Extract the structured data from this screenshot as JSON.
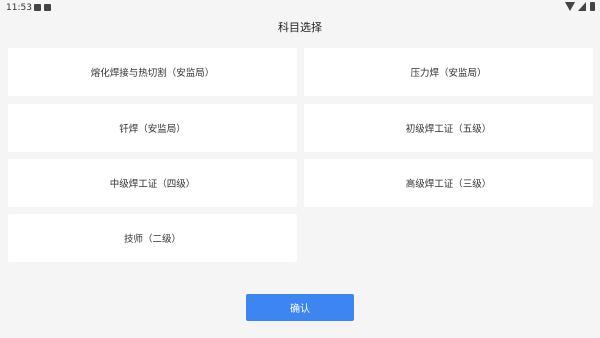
{
  "status_bar": {
    "time": "11:53",
    "icons": [
      "image-icon",
      "notification-icon",
      "wifi-icon",
      "cell-signal-icon",
      "battery-icon"
    ]
  },
  "header": {
    "title": "科目选择"
  },
  "options": [
    "熔化焊接与热切割（安监局）",
    "压力焊（安监局）",
    "钎焊（安监局）",
    "初级焊工证（五级）",
    "中级焊工证（四级）",
    "高级焊工证（三级）",
    "技师（二级）"
  ],
  "confirm_button": {
    "label": "确认",
    "color": "#3d85f0"
  }
}
